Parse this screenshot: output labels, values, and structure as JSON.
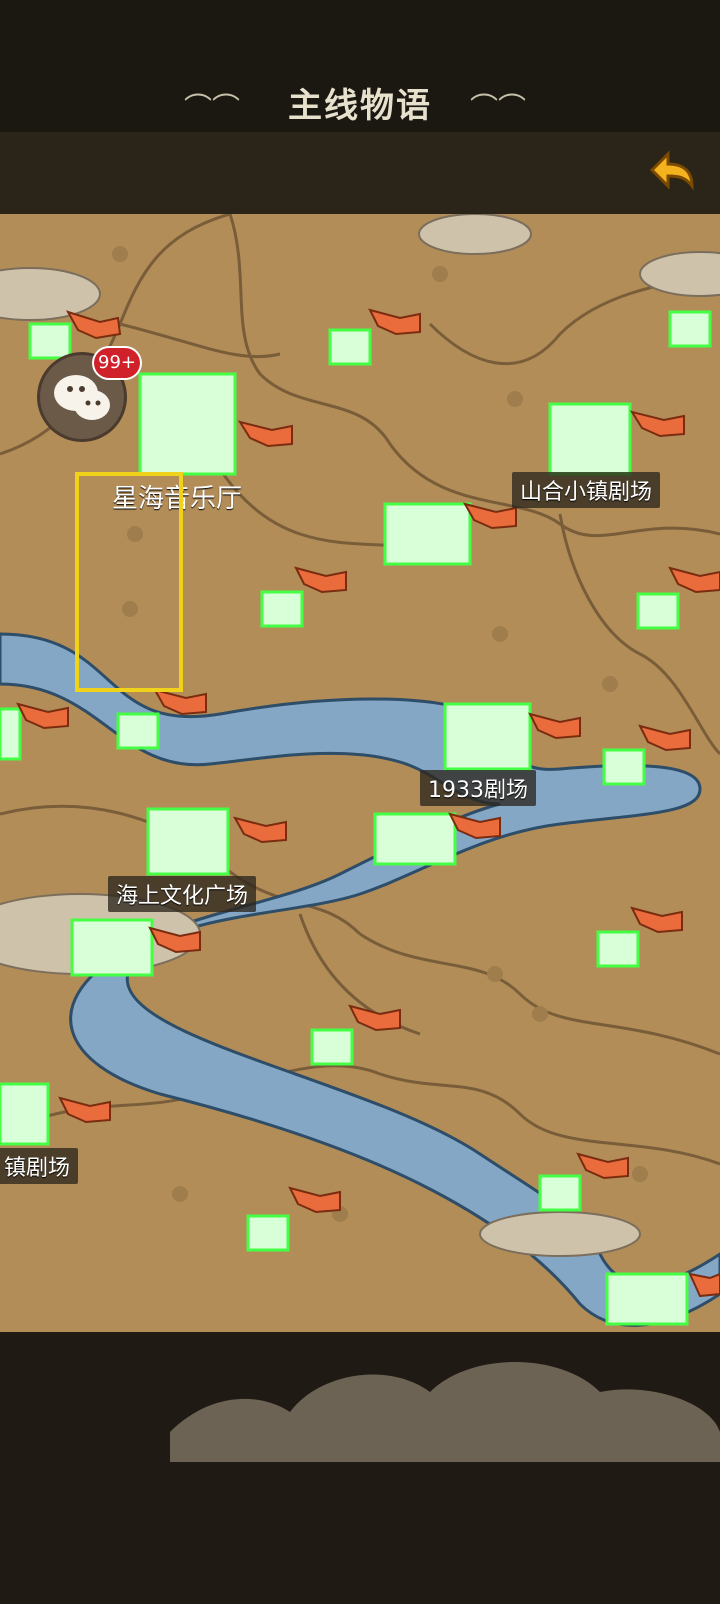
{
  "header": {
    "title": "主线物语"
  },
  "wechat": {
    "badge": "99+"
  },
  "venues": {
    "star_sea_hall": "星海音乐厅",
    "shanhe_theater": "山合小镇剧场",
    "theater_1933": "1933剧场",
    "shanghai_culture": "海上文化广场",
    "town_theater_left": "镇剧场"
  },
  "colors": {
    "map_ground": "#b28d58",
    "river": "#84a7c6",
    "building_glow": "#44ff44",
    "flag": "#ea6c3c",
    "highlight_box": "#f0d21b"
  }
}
